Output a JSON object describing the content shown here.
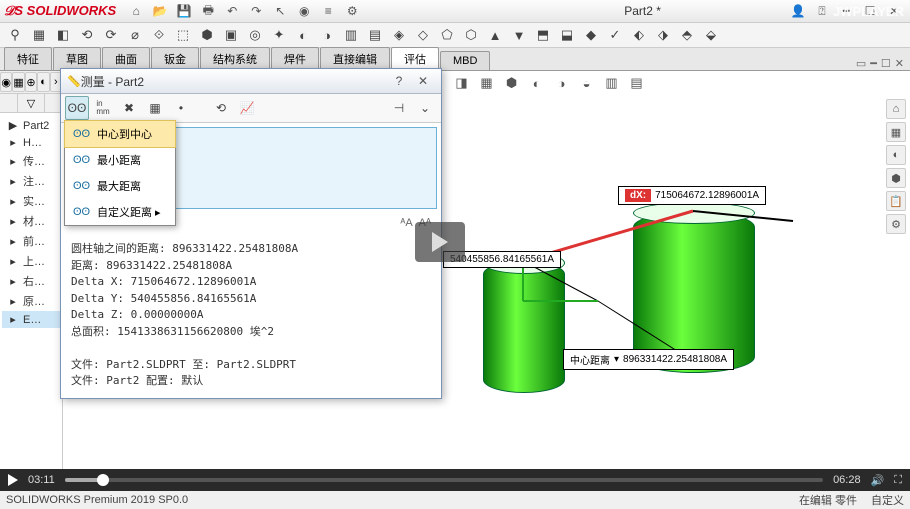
{
  "app": {
    "brand": "SOLIDWORKS",
    "doc": "Part2 *",
    "watermark": "JWPLAYER"
  },
  "titlebar_icons": [
    "home",
    "open",
    "save",
    "print",
    "undo",
    "redo",
    "select",
    "rebuild",
    "options",
    "settings"
  ],
  "tabs": [
    "特征",
    "草图",
    "曲面",
    "钣金",
    "结构系统",
    "焊件",
    "直接编辑",
    "评估",
    "MBD"
  ],
  "active_tab": "评估",
  "tree": {
    "root": "Part2",
    "items": [
      "H…",
      "传…",
      "注…",
      "实…",
      "材…",
      "前…",
      "上…",
      "右…",
      "原…",
      "E…"
    ]
  },
  "measure": {
    "title": "测量 - Part2",
    "toolbar": [
      "arc",
      "inmm",
      "xy",
      "cal",
      "dot",
      "pin",
      "chart"
    ],
    "dropdown": [
      "中心到中心",
      "最小距离",
      "最大距离",
      "自定义距离 ▸"
    ],
    "dropdown_selected": 0,
    "results": [
      "圆柱轴之间的距离:  896331422.25481808A",
      "距离:  896331422.25481808A",
      "Delta X:  715064672.12896001A",
      "Delta Y:  540455856.84165561A",
      "Delta Z:  0.00000000A",
      "总面积:  1541338631156620800 埃^2",
      "",
      "文件:  Part2.SLDPRT 至:  Part2.SLDPRT",
      "文件:  Part2 配置:  默认"
    ]
  },
  "callouts": {
    "dx": {
      "label": "dX:",
      "value": "715064672.12896001A"
    },
    "dy": {
      "value": "540455856.84165561A"
    },
    "dist": {
      "label": "中心距离",
      "value": "896331422.25481808A"
    }
  },
  "player": {
    "current": "03:11",
    "total": "06:28"
  },
  "status": {
    "left": "SOLIDWORKS Premium 2019 SP0.0",
    "mode": "在编辑 零件",
    "custom": "自定义"
  }
}
